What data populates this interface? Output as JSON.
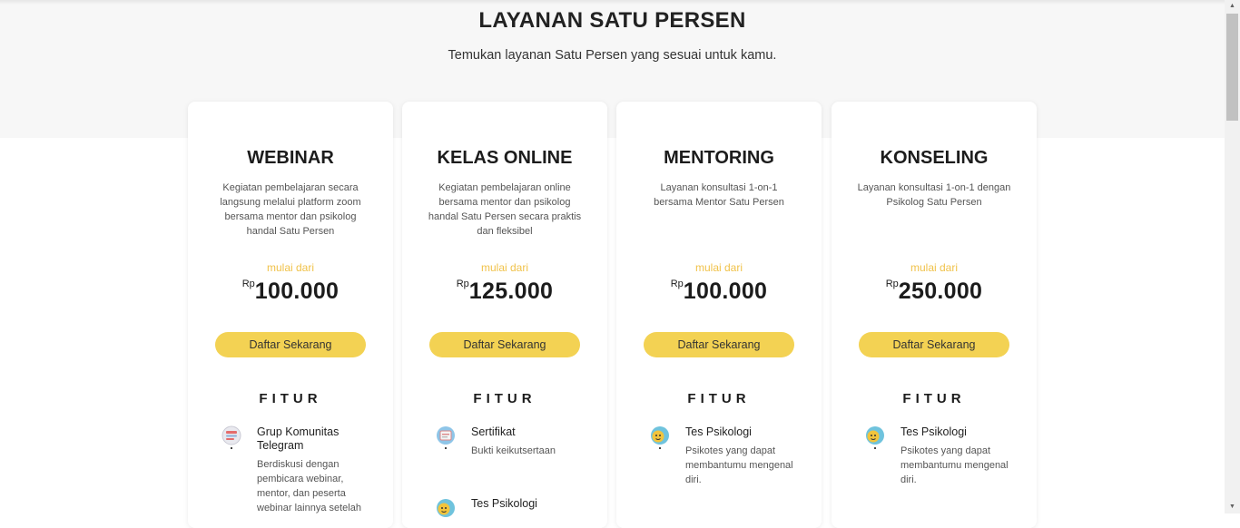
{
  "header": {
    "title": "LAYANAN SATU PERSEN",
    "subtitle": "Temukan layanan Satu Persen yang sesuai untuk kamu."
  },
  "colors": {
    "accent_yellow": "#f3d253",
    "price_prefix": "#f0c24a",
    "band_bg": "#f7f7f7"
  },
  "cards": [
    {
      "title": "WEBINAR",
      "description": "Kegiatan pembelajaran secara langsung melalui platform zoom bersama mentor dan psikolog handal Satu Persen",
      "price_prefix": "mulai dari",
      "currency": "Rp",
      "price": "100.000",
      "cta": "Daftar Sekarang",
      "features_heading": "FITUR",
      "features": [
        {
          "icon": "group-chat-icon",
          "title": "Grup Komunitas Telegram",
          "desc": "Berdiskusi dengan pembicara webinar, mentor, dan peserta webinar lainnya setelah"
        }
      ]
    },
    {
      "title": "KELAS ONLINE",
      "description": "Kegiatan pembelajaran online bersama mentor dan psikolog handal Satu Persen secara praktis dan fleksibel",
      "price_prefix": "mulai dari",
      "currency": "Rp",
      "price": "125.000",
      "cta": "Daftar Sekarang",
      "features_heading": "FITUR",
      "features": [
        {
          "icon": "certificate-icon",
          "title": "Sertifikat",
          "desc": "Bukti keikutsertaan"
        },
        {
          "icon": "psych-test-icon",
          "title": "Tes Psikologi",
          "desc": ""
        }
      ]
    },
    {
      "title": "MENTORING",
      "description": "Layanan konsultasi 1-on-1 bersama Mentor Satu Persen",
      "price_prefix": "mulai dari",
      "currency": "Rp",
      "price": "100.000",
      "cta": "Daftar Sekarang",
      "features_heading": "FITUR",
      "features": [
        {
          "icon": "psych-test-icon",
          "title": "Tes Psikologi",
          "desc": "Psikotes yang dapat membantumu mengenal diri."
        }
      ]
    },
    {
      "title": "KONSELING",
      "description": "Layanan konsultasi 1-on-1 dengan Psikolog Satu Persen",
      "price_prefix": "mulai dari",
      "currency": "Rp",
      "price": "250.000",
      "cta": "Daftar Sekarang",
      "features_heading": "FITUR",
      "features": [
        {
          "icon": "psych-test-icon",
          "title": "Tes Psikologi",
          "desc": "Psikotes yang dapat membantumu mengenal diri."
        }
      ]
    }
  ]
}
